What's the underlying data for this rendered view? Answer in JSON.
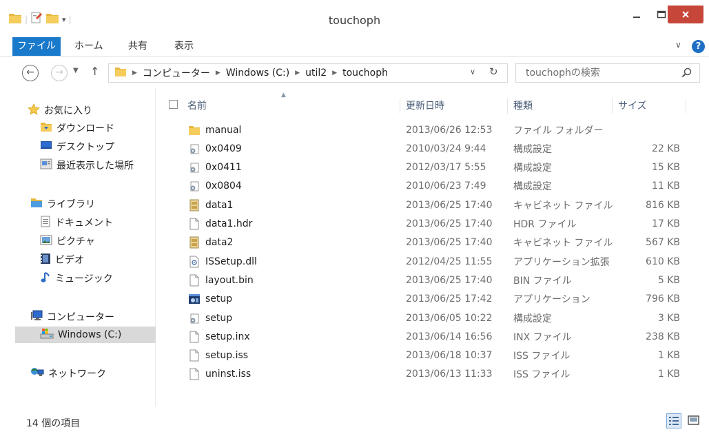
{
  "window": {
    "title": "touchoph"
  },
  "ribbon": {
    "tabs": [
      "ファイル",
      "ホーム",
      "共有",
      "表示"
    ]
  },
  "address": {
    "crumbs": [
      "コンピューター",
      "Windows (C:)",
      "util2",
      "touchoph"
    ],
    "search_placeholder": "touchophの検索"
  },
  "navpane": {
    "favorites_label": "お気に入り",
    "favorites": [
      "ダウンロード",
      "デスクトップ",
      "最近表示した場所"
    ],
    "libraries_label": "ライブラリ",
    "libraries": [
      "ドキュメント",
      "ピクチャ",
      "ビデオ",
      "ミュージック"
    ],
    "computer_label": "コンピューター",
    "computer": [
      "Windows (C:)"
    ],
    "network_label": "ネットワーク"
  },
  "columns": {
    "name": "名前",
    "date": "更新日時",
    "type": "種類",
    "size": "サイズ"
  },
  "files": [
    {
      "name": "manual",
      "date": "2013/06/26 12:53",
      "type": "ファイル フォルダー",
      "size": "",
      "icon": "folder-icon"
    },
    {
      "name": "0x0409",
      "date": "2010/03/24 9:44",
      "type": "構成設定",
      "size": "22 KB",
      "icon": "config-file-icon"
    },
    {
      "name": "0x0411",
      "date": "2012/03/17 5:55",
      "type": "構成設定",
      "size": "15 KB",
      "icon": "config-file-icon"
    },
    {
      "name": "0x0804",
      "date": "2010/06/23 7:49",
      "type": "構成設定",
      "size": "11 KB",
      "icon": "config-file-icon"
    },
    {
      "name": "data1",
      "date": "2013/06/25 17:40",
      "type": "キャビネット ファイル",
      "size": "816 KB",
      "icon": "cabinet-file-icon"
    },
    {
      "name": "data1.hdr",
      "date": "2013/06/25 17:40",
      "type": "HDR ファイル",
      "size": "17 KB",
      "icon": "blank-file-icon"
    },
    {
      "name": "data2",
      "date": "2013/06/25 17:40",
      "type": "キャビネット ファイル",
      "size": "567 KB",
      "icon": "cabinet-file-icon"
    },
    {
      "name": "ISSetup.dll",
      "date": "2012/04/25 11:55",
      "type": "アプリケーション拡張",
      "size": "610 KB",
      "icon": "dll-file-icon"
    },
    {
      "name": "layout.bin",
      "date": "2013/06/25 17:40",
      "type": "BIN ファイル",
      "size": "5 KB",
      "icon": "blank-file-icon"
    },
    {
      "name": "setup",
      "date": "2013/06/25 17:42",
      "type": "アプリケーション",
      "size": "796 KB",
      "icon": "application-icon"
    },
    {
      "name": "setup",
      "date": "2013/06/05 10:22",
      "type": "構成設定",
      "size": "3 KB",
      "icon": "config-file-icon"
    },
    {
      "name": "setup.inx",
      "date": "2013/06/14 16:56",
      "type": "INX ファイル",
      "size": "238 KB",
      "icon": "blank-file-icon"
    },
    {
      "name": "setup.iss",
      "date": "2013/06/18 10:37",
      "type": "ISS ファイル",
      "size": "1 KB",
      "icon": "blank-file-icon"
    },
    {
      "name": "uninst.iss",
      "date": "2013/06/13 11:33",
      "type": "ISS ファイル",
      "size": "1 KB",
      "icon": "blank-file-icon"
    }
  ],
  "status": {
    "item_count": "14 個の項目"
  },
  "colors": {
    "accent": "#1979ca",
    "close": "#c7463a",
    "folder": "#e8b844"
  }
}
